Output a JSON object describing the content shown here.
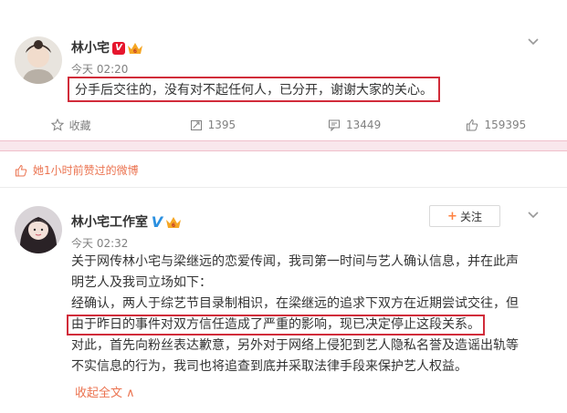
{
  "post1": {
    "username": "林小宅",
    "time": "今天 02:20",
    "text": "分手后交往的，没有对不起任何人，已分开，谢谢大家的关心。",
    "actions": [
      {
        "icon": "star-icon",
        "label": "收藏"
      },
      {
        "icon": "repost-icon",
        "label": "1395"
      },
      {
        "icon": "comment-icon",
        "label": "13449"
      },
      {
        "icon": "like-icon",
        "label": "159395"
      }
    ]
  },
  "liked_notice": "她1小时前赞过的微博",
  "post2": {
    "username": "林小宅工作室",
    "time": "今天 02:32",
    "follow_label": "关注",
    "lines": [
      "关于网传林小宅与梁继远的恋爱传闻，我司第一时间与艺人确认信息，并在此声",
      "明艺人及我司立场如下：",
      "经确认，两人于综艺节目录制相识，在梁继远的追求下双方在近期尝试交往，但",
      "由于昨日的事件对双方信任造成了严重的影响，现已决定停止这段关系。",
      "对此，首先向粉丝表达歉意，另外对于网络上侵犯到艺人隐私名誉及造谣出轨等",
      "不实信息的行为，我司也将追查到底并采取法律手段来保护艺人权益。"
    ],
    "collapse_label": "收起全文 ∧"
  },
  "colors": {
    "accent_red": "#d12c3a",
    "link_orange": "#eb7350",
    "meta_gray": "#808080",
    "pink_bar": "#f9e7ec"
  }
}
